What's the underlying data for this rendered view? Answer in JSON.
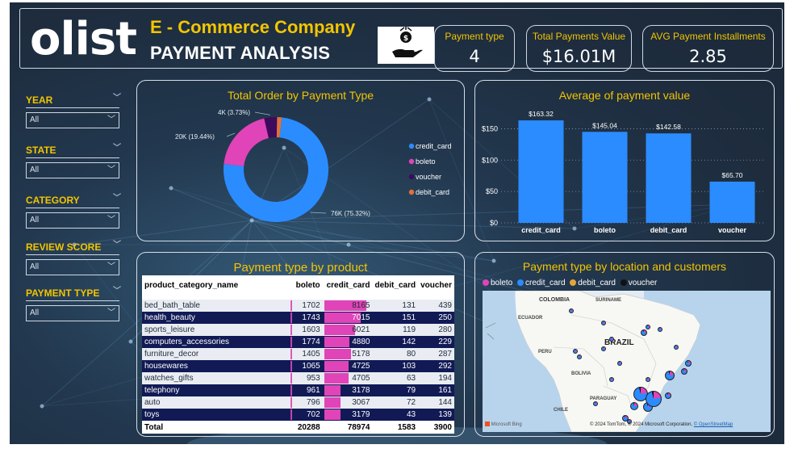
{
  "header": {
    "logo": "olist",
    "company": "E - Commerce Company",
    "subtitle": "PAYMENT ANALYSIS",
    "icon": "hand-money-icon"
  },
  "kpis": [
    {
      "label": "Payment type",
      "value": "4"
    },
    {
      "label": "Total Payments Value",
      "value": "$16.01M"
    },
    {
      "label": "AVG Payment Installments",
      "value": "2.85"
    }
  ],
  "slicers": [
    {
      "label": "YEAR",
      "value": "All"
    },
    {
      "label": "STATE",
      "value": "All"
    },
    {
      "label": "CATEGORY",
      "value": "All"
    },
    {
      "label": "REVIEW SCORE",
      "value": "All"
    },
    {
      "label": "PAYMENT TYPE",
      "value": "All"
    }
  ],
  "colors": {
    "credit_card": "#2b8cff",
    "boleto": "#e044b8",
    "voucher": "#3d0a5c",
    "debit_card": "#e0703a",
    "accent": "#f2c500"
  },
  "chart_data": [
    {
      "type": "pie",
      "title": "Total Order by Payment Type",
      "labels": [
        "credit_card",
        "boleto",
        "voucher",
        "debit_card"
      ],
      "values": [
        76,
        20,
        4,
        1.5
      ],
      "percents": [
        75.32,
        19.44,
        3.73,
        1.51
      ],
      "data_labels": [
        "76K (75.32%)",
        "20K (19.44%)",
        "4K (3.73%)",
        ""
      ],
      "legend": [
        "credit_card",
        "boleto",
        "voucher",
        "debit_card"
      ],
      "legend_position": "right"
    },
    {
      "type": "bar",
      "title": "Average of payment value",
      "categories": [
        "credit_card",
        "boleto",
        "debit_card",
        "voucher"
      ],
      "values": [
        163.32,
        145.04,
        142.58,
        65.7
      ],
      "data_labels": [
        "$163.32",
        "$145.04",
        "$142.58",
        "$65.70"
      ],
      "yticks": [
        "$0",
        "$50",
        "$100",
        "$150"
      ],
      "ylim": [
        0,
        175
      ],
      "grid": true
    }
  ],
  "table": {
    "title": "Payment type by product",
    "columns": [
      "product_category_name",
      "boleto",
      "credit_card",
      "debit_card",
      "voucher"
    ],
    "rows": [
      [
        "bed_bath_table",
        "1702",
        "8165",
        "131",
        "439"
      ],
      [
        "health_beauty",
        "1743",
        "7015",
        "151",
        "250"
      ],
      [
        "sports_leisure",
        "1603",
        "6021",
        "119",
        "280"
      ],
      [
        "computers_accessories",
        "1774",
        "4880",
        "142",
        "229"
      ],
      [
        "furniture_decor",
        "1405",
        "5178",
        "80",
        "287"
      ],
      [
        "housewares",
        "1065",
        "4725",
        "103",
        "292"
      ],
      [
        "watches_gifts",
        "953",
        "4705",
        "63",
        "194"
      ],
      [
        "telephony",
        "961",
        "3178",
        "79",
        "161"
      ],
      [
        "auto",
        "796",
        "3067",
        "72",
        "144"
      ],
      [
        "toys",
        "702",
        "3179",
        "43",
        "139"
      ]
    ],
    "total": [
      "Total",
      "20288",
      "78974",
      "1583",
      "3900"
    ]
  },
  "map": {
    "title": "Payment type by location and customers",
    "legend": [
      "boleto",
      "credit_card",
      "debit_card",
      "voucher"
    ],
    "labels": [
      "COLOMBIA",
      "SURINAME",
      "ECUADOR",
      "BRAZIL",
      "PERU",
      "BOLIVIA",
      "PARAGUAY",
      "CHILE"
    ],
    "provider": "Microsoft Bing",
    "credits": "© 2024 TomTom, © 2024 Microsoft Corporation,",
    "osm": "© OpenStreetMap"
  }
}
